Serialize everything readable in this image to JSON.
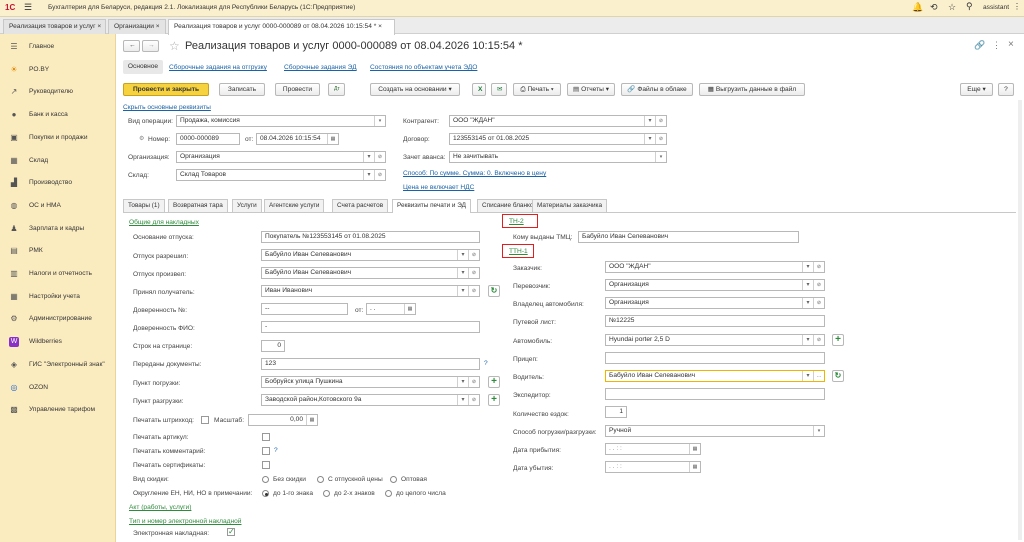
{
  "topbar": {
    "logo": "1С",
    "title": "Бухгалтерия для Беларуси, редакция 2.1. Локализация для Республики Беларусь  (1С:Предприятие)",
    "user": "assistant"
  },
  "tabs": [
    {
      "label": "Реализация товаров и услуг"
    },
    {
      "label": "Организации"
    },
    {
      "label": "Реализация товаров и услуг 0000-000089 от 08.04.2026 10:15:54 *"
    }
  ],
  "sidebar": [
    {
      "label": "Главное",
      "icon": "menu-icon"
    },
    {
      "label": "PO.BY",
      "icon": "sun-icon"
    },
    {
      "label": "Руководителю",
      "icon": "chart-icon"
    },
    {
      "label": "Банк и касса",
      "icon": "coin-icon"
    },
    {
      "label": "Покупки и продажи",
      "icon": "cart-icon"
    },
    {
      "label": "Склад",
      "icon": "warehouse-icon"
    },
    {
      "label": "Производство",
      "icon": "factory-icon"
    },
    {
      "label": "ОС и НМА",
      "icon": "car-icon"
    },
    {
      "label": "Зарплата и кадры",
      "icon": "people-icon"
    },
    {
      "label": "РМК",
      "icon": "register-icon"
    },
    {
      "label": "Налоги и отчетность",
      "icon": "report-icon"
    },
    {
      "label": "Настройки учета",
      "icon": "settings-icon"
    },
    {
      "label": "Администрирование",
      "icon": "gear-icon"
    },
    {
      "label": "Wildberries",
      "icon": "wb-icon"
    },
    {
      "label": "ГИС \"Электронный знак\"",
      "icon": "gis-icon"
    },
    {
      "label": "OZON",
      "icon": "ozon-icon"
    },
    {
      "label": "Управление тарифом",
      "icon": "tariff-icon"
    }
  ],
  "doc": {
    "title": "Реализация товаров и услуг 0000-000089 от 08.04.2026 10:15:54 *"
  },
  "subnav": [
    "Основное",
    "Сборочные задания на отгрузку",
    "Сборочные задания ЭД",
    "Состояния по объектам учета ЭДО"
  ],
  "toolbar": {
    "post_close": "Провести и закрыть",
    "save": "Записать",
    "post": "Провести",
    "create_based": "Создать на основании",
    "print": "Печать",
    "reports": "Отчеты",
    "files": "Файлы в облаке",
    "upload": "Выгрузить данные в файл",
    "more": "Еще",
    "help": "?"
  },
  "hide_link": "Скрыть основные реквизиты",
  "header": {
    "op_label": "Вид операции:",
    "op_value": "Продажа, комиссия",
    "num_label": "Номер:",
    "num_value": "0000-000089",
    "from_label": "от:",
    "date_value": "08.04.2026 10:15:54",
    "org_label": "Организация:",
    "org_value": "Организация",
    "wh_label": "Склад:",
    "wh_value": "Склад Товаров",
    "contr_label": "Контрагент:",
    "contr_value": "ООО \"ЖДАН\"",
    "contract_label": "Договор:",
    "contract_value": "123553145 от 01.08.2025",
    "advance_label": "Зачет аванса:",
    "advance_value": "Не зачитывать",
    "method_link": "Способ: По сумме. Сумма: 0. Включено в цену",
    "vat_link": "Цена не включает НДС"
  },
  "form_tabs": [
    "Товары (1)",
    "Возвратная тара",
    "Услуги",
    "Агентские услуги",
    "Счета расчетов",
    "Реквизиты печати и ЭД",
    "Списание бланков",
    "Материалы заказчика"
  ],
  "left": {
    "common_link": "Общие для накладных",
    "basis_label": "Основание отпуска:",
    "basis_value": "Покупатель №123553145 от 01.08.2025",
    "allowed_label": "Отпуск разрешил:",
    "allowed_value": "Бабуйло Иван Селеванович",
    "made_label": "Отпуск произвел:",
    "made_value": "Бабуйло Иван Селеванович",
    "receiver_label": "Принял получатель:",
    "receiver_value": "Иван Иванович",
    "proxy_label": "Доверенность №:",
    "proxy_value": "--",
    "proxy_from": "от:",
    "proxy_date": ".  .",
    "proxyfio_label": "Доверенность ФИО:",
    "proxyfio_value": "-",
    "lines_label": "Строк на странице:",
    "lines_value": "0",
    "docs_label": "Переданы документы:",
    "docs_value": "123",
    "docs_q": "?",
    "load_label": "Пункт погрузки:",
    "load_value": "Бобруйск улица Пушкина",
    "unload_label": "Пункт разгрузки:",
    "unload_value": "Заводской район,Котовского 9а",
    "barcode_label": "Печатать штрихкод:",
    "scale_label": "Масштаб:",
    "scale_value": "0,00",
    "article_label": "Печатать артикул:",
    "comment_label": "Печатать комментарий:",
    "comment_q": "?",
    "cert_label": "Печатать сертификаты:",
    "discount_label": "Вид скидки:",
    "disc_opts": [
      "Без скидки",
      "С отпускной цены",
      "Оптовая"
    ],
    "round_label": "Округление ЕН, НИ, НО в примечании:",
    "round_opts": [
      "до 1-го знака",
      "до 2-х знаков",
      "до целого числа"
    ],
    "act_link": "Акт (работы, услуги)",
    "etype_link": "Тип и номер электронной накладной",
    "enakl_label": "Электронная накладная:"
  },
  "right": {
    "tn2_link": "ТН-2",
    "tmc_label": "Кому выданы ТМЦ:",
    "tmc_value": "Бабуйло Иван Селеванович",
    "ttn1_link": "ТТН-1",
    "customer_label": "Заказчик:",
    "customer_value": "ООО \"ЖДАН\"",
    "carrier_label": "Перевозчик:",
    "carrier_value": "Организация",
    "owner_label": "Владелец автомобиля:",
    "owner_value": "Организация",
    "waybill_label": "Путевой лист:",
    "waybill_value": "№12225",
    "car_label": "Автомобиль:",
    "car_value": "Hyundai porter 2,5 D",
    "trailer_label": "Прицеп:",
    "trailer_value": "",
    "driver_label": "Водитель:",
    "driver_value": "Бабуйло Иван Селеванович",
    "forwarder_label": "Экспедитор:",
    "forwarder_value": "",
    "rides_label": "Количество ездок:",
    "rides_value": "1",
    "method_label": "Способ погрузки/разгрузки:",
    "method_value": "Ручной",
    "arrival_label": "Дата прибытия:",
    "arrival_value": ".  .     :  :",
    "departure_label": "Дата убытия:",
    "departure_value": ".  .     :  :"
  },
  "colors": {
    "accent": "#f7d23f",
    "sidebar": "#fbecc0",
    "link": "#1a63a8",
    "highlight": "#e02020"
  }
}
